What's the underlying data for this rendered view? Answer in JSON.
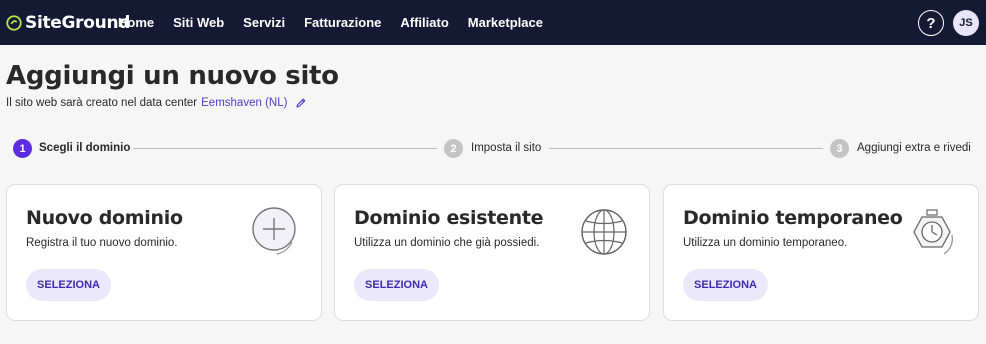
{
  "brand": {
    "logo_text": "SiteGround"
  },
  "nav": {
    "items": [
      "Home",
      "Siti Web",
      "Servizi",
      "Fatturazione",
      "Affiliato",
      "Marketplace"
    ],
    "help_label": "?",
    "avatar_initials": "JS"
  },
  "page": {
    "title": "Aggiungi un nuovo sito",
    "subtitle_prefix": "Il sito web sarà creato nel data center",
    "data_center": "Eemshaven (NL)"
  },
  "stepper": {
    "steps": [
      {
        "number": "1",
        "label": "Scegli il dominio",
        "state": "active"
      },
      {
        "number": "2",
        "label": "Imposta il sito",
        "state": "inactive"
      },
      {
        "number": "3",
        "label": "Aggiungi extra e rivedi",
        "state": "inactive"
      }
    ]
  },
  "cards": [
    {
      "title": "Nuovo dominio",
      "description": "Registra il tuo nuovo dominio.",
      "button": "SELEZIONA",
      "icon": "plus-circle-icon"
    },
    {
      "title": "Dominio esistente",
      "description": "Utilizza un dominio che già possiedi.",
      "button": "SELEZIONA",
      "icon": "globe-icon"
    },
    {
      "title": "Dominio temporaneo",
      "description": "Utilizza un dominio temporaneo.",
      "button": "SELEZIONA",
      "icon": "stopwatch-icon"
    }
  ],
  "colors": {
    "topbar": "#141a34",
    "accent": "#5b2ce0",
    "link": "#4a3bd6",
    "button_bg": "#ece8fb",
    "button_text": "#3d2bb8"
  }
}
